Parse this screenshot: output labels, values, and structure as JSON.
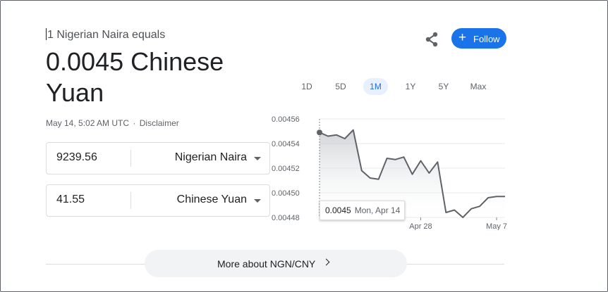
{
  "converter": {
    "subtitle": "1 Nigerian Naira equals",
    "rate_headline": "0.0045 Chinese Yuan",
    "timestamp": "May 14, 5:02 AM UTC",
    "separator": "·",
    "disclaimer": "Disclaimer",
    "from": {
      "value": "9239.56",
      "currency": "Nigerian Naira"
    },
    "to": {
      "value": "41.55",
      "currency": "Chinese Yuan"
    }
  },
  "actions": {
    "share_icon": "share-icon",
    "follow_label": "Follow",
    "follow_icon": "+"
  },
  "ranges": {
    "items": [
      "1D",
      "5D",
      "1M",
      "1Y",
      "5Y",
      "Max"
    ],
    "active": "1M"
  },
  "tooltip": {
    "value": "0.0045",
    "date": "Mon, Apr 14"
  },
  "more": {
    "label": "More about NGN/CNY"
  },
  "colors": {
    "accent": "#1a73e8",
    "line": "#5f6368",
    "gridline": "#e8eaed"
  },
  "chart_data": {
    "type": "area",
    "title": "",
    "xlabel": "",
    "ylabel": "",
    "ylim": [
      0.00448,
      0.00456
    ],
    "y_ticks": [
      "0.00456",
      "0.00454",
      "0.00452",
      "0.00450",
      "0.00448"
    ],
    "y_tick_values": [
      0.00456,
      0.00454,
      0.00452,
      0.0045,
      0.00448
    ],
    "x_tick_labels": [
      "Apr 28",
      "May 7"
    ],
    "x_tick_index": [
      12,
      21
    ],
    "grid": true,
    "series": [
      {
        "values": [
          0.004549,
          0.004546,
          0.004547,
          0.004544,
          0.004551,
          0.004518,
          0.004512,
          0.004511,
          0.004528,
          0.004527,
          0.004529,
          0.004515,
          0.004526,
          0.004516,
          0.004525,
          0.004484,
          0.004486,
          0.00448,
          0.004487,
          0.004489,
          0.004496,
          0.004497,
          0.004497
        ]
      }
    ]
  }
}
